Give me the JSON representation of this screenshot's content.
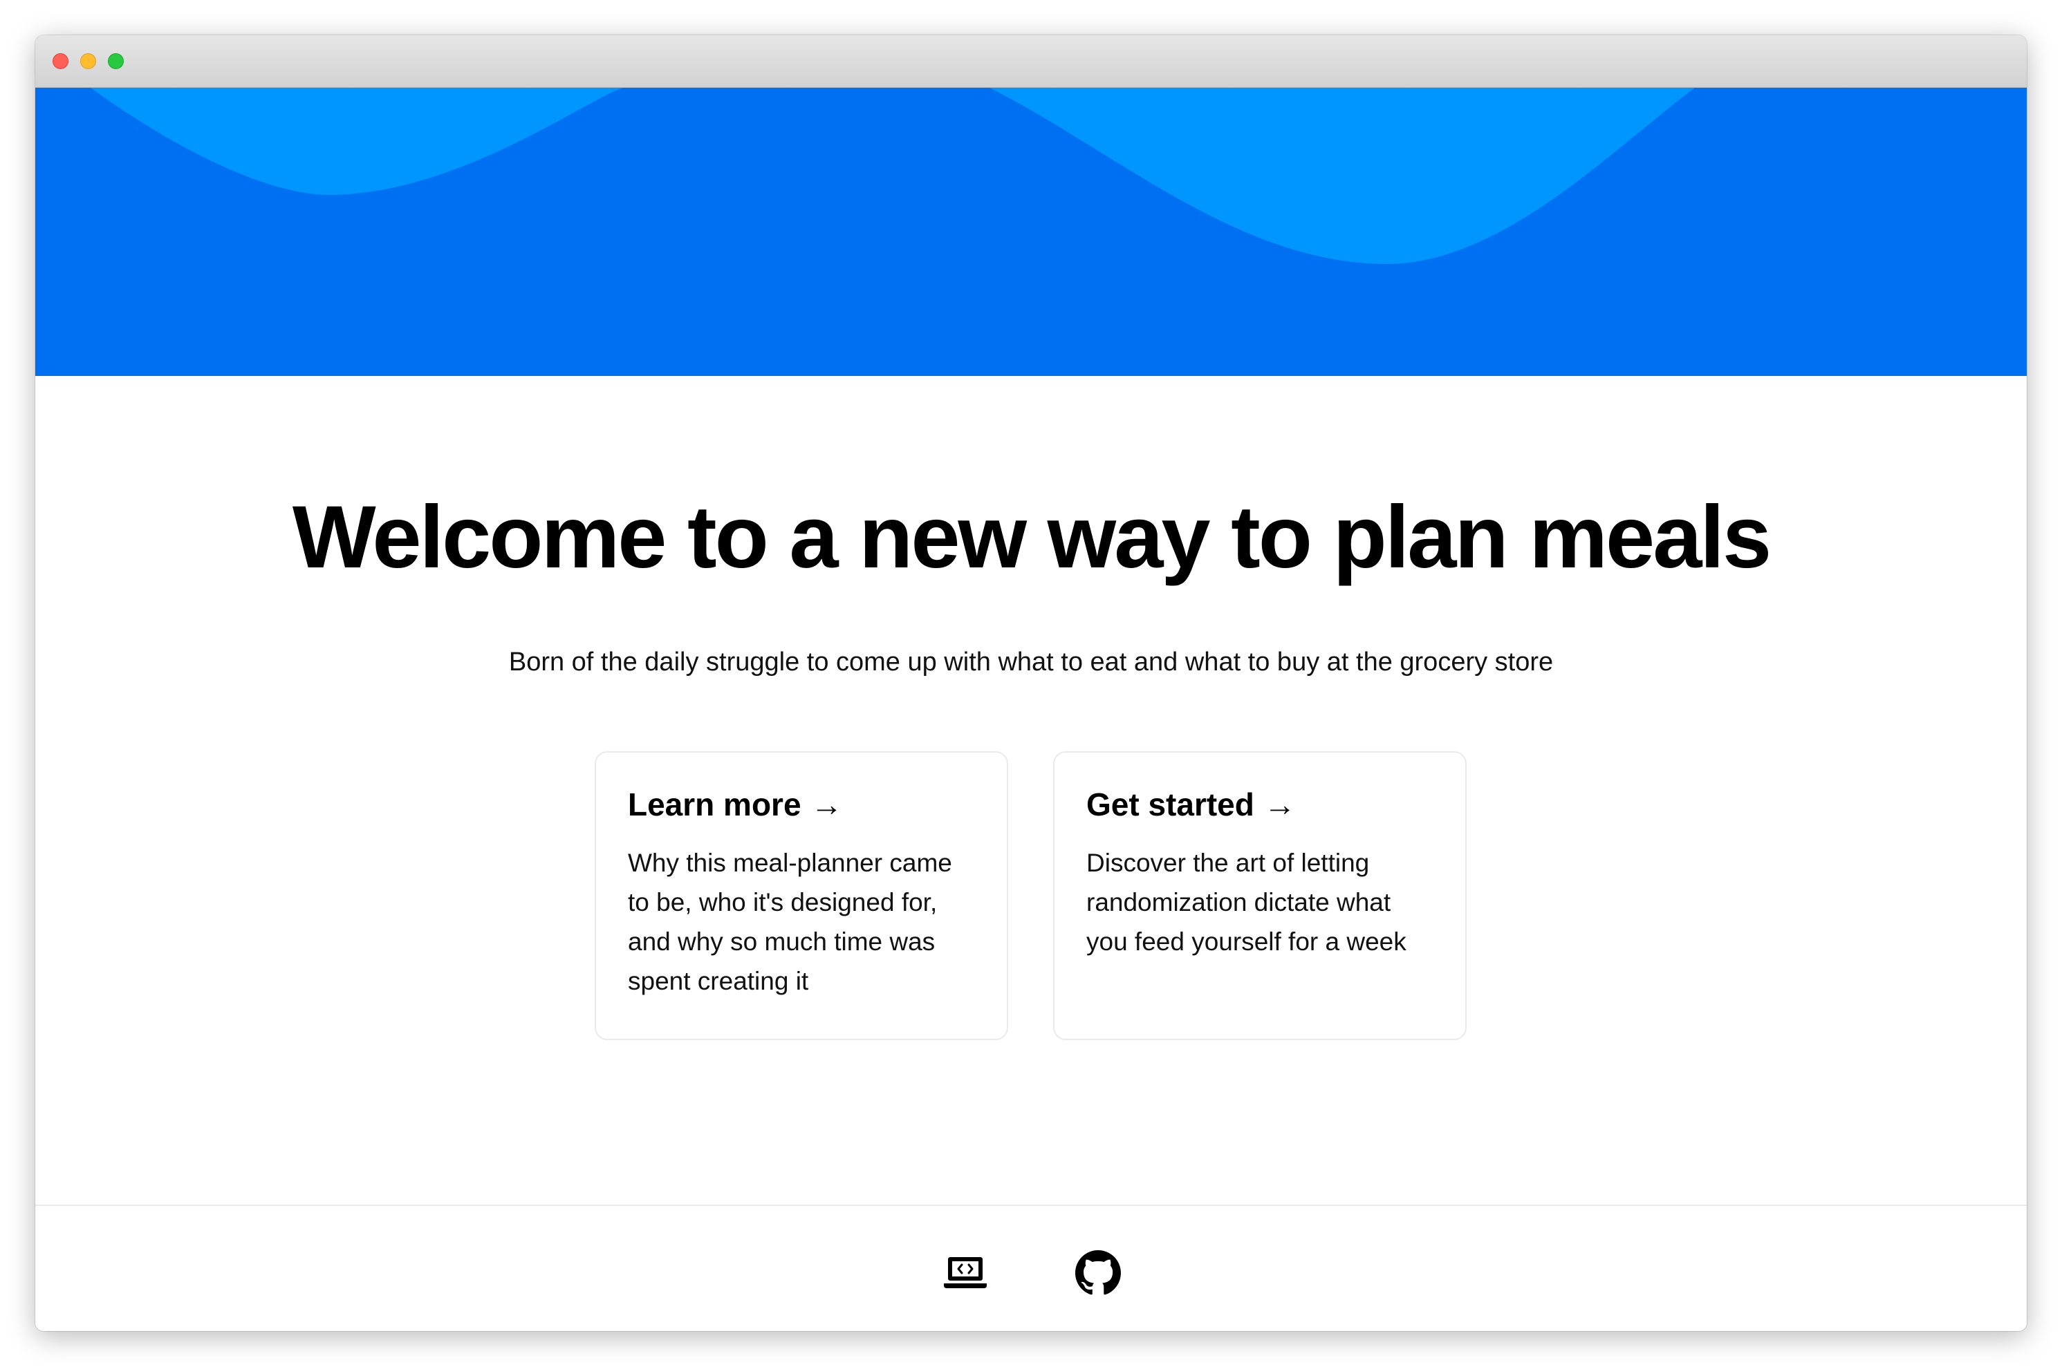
{
  "window": {
    "traffic_lights": [
      "close",
      "minimize",
      "maximize"
    ]
  },
  "hero": {
    "background_color": "#0070f3",
    "wave_color": "#0096ff"
  },
  "main": {
    "headline": "Welcome to a new way to plan meals",
    "subtitle": "Born of the daily struggle to come up with what to eat and what to buy at the grocery store"
  },
  "cards": [
    {
      "title": "Learn more",
      "arrow": "→",
      "description": "Why this meal-planner came to be, who it's designed for, and why so much time was spent creating it"
    },
    {
      "title": "Get started",
      "arrow": "→",
      "description": "Discover the art of letting randomization dictate what you feed yourself for a week"
    }
  ],
  "footer": {
    "icons": [
      "laptop-code-icon",
      "github-icon"
    ]
  }
}
